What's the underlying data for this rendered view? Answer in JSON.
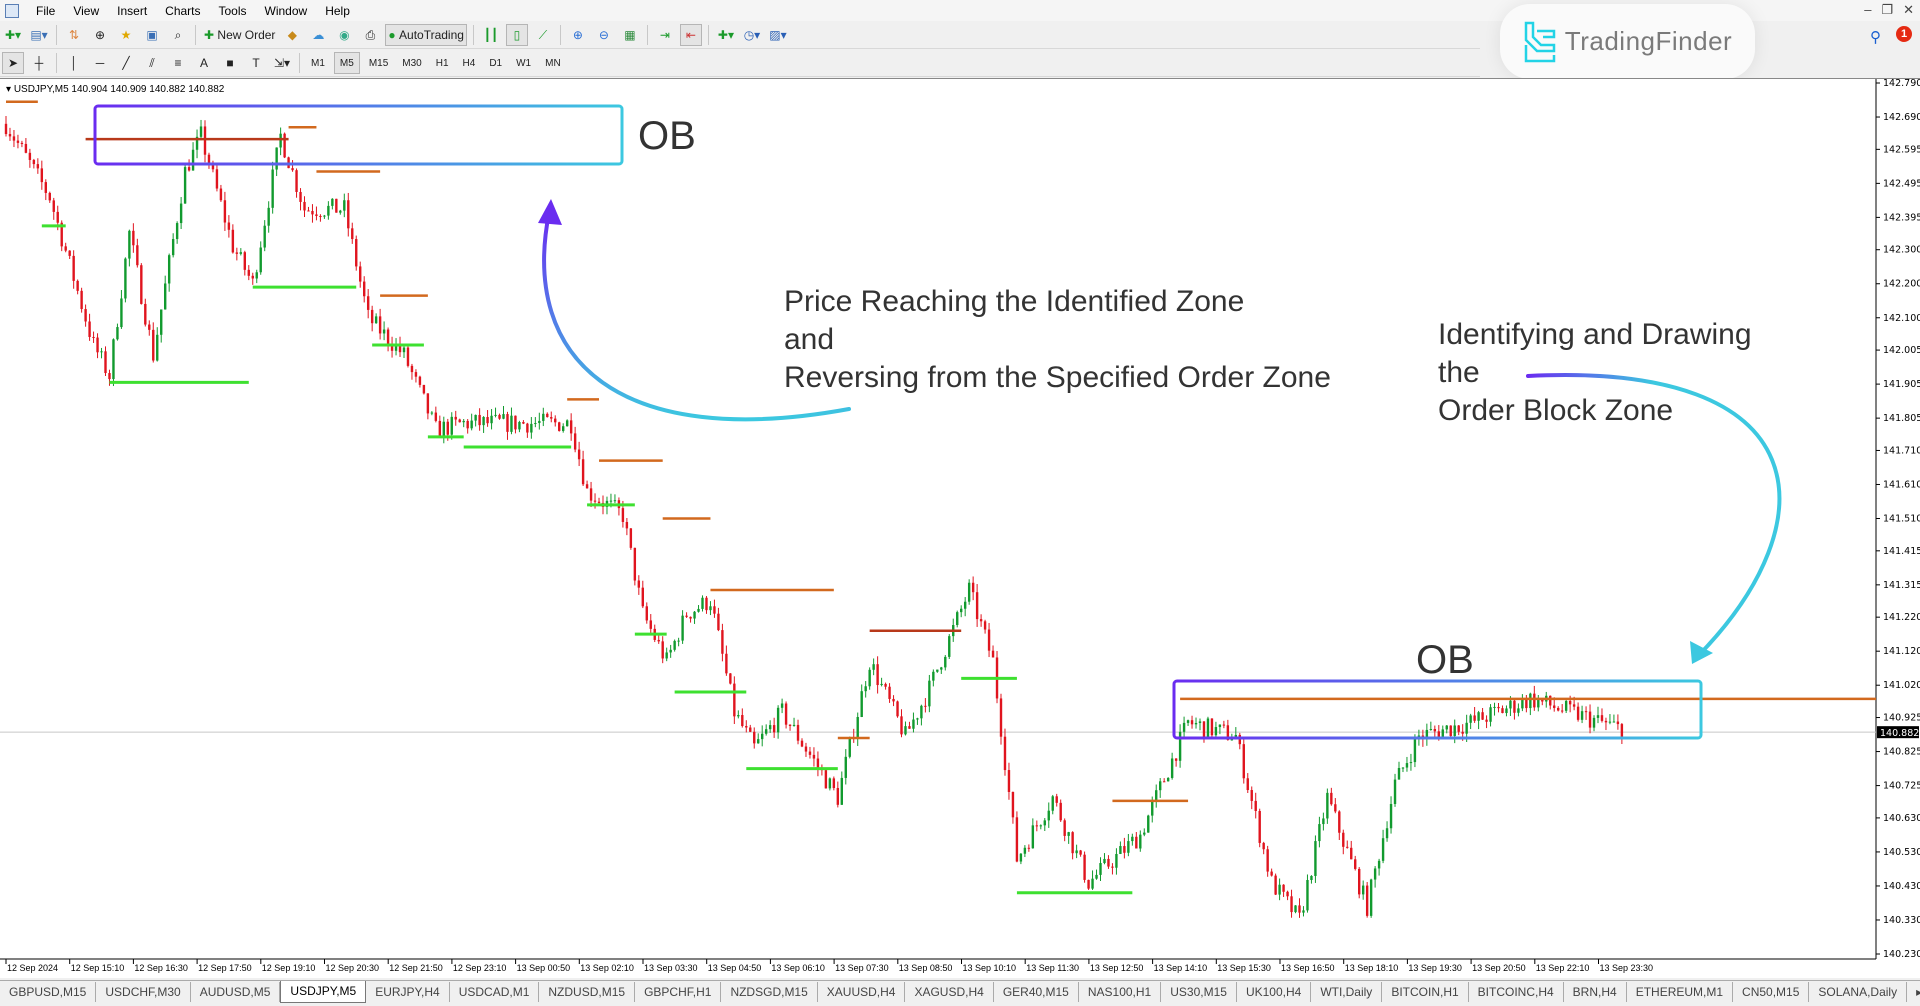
{
  "menu": [
    "File",
    "View",
    "Insert",
    "Charts",
    "Tools",
    "Window",
    "Help"
  ],
  "toolbar": {
    "new_order": "New Order",
    "auto_trading": "AutoTrading",
    "timeframes": [
      "M1",
      "M5",
      "M15",
      "M30",
      "H1",
      "H4",
      "D1",
      "W1",
      "MN"
    ],
    "active_timeframe": "M5"
  },
  "brand": {
    "logo_text": "TradingFinder",
    "accent": "#22d3e6"
  },
  "notifications": {
    "count": "1"
  },
  "chart": {
    "header": "USDJPY,M5  140.904 140.909 140.882 140.882",
    "current_price": "140.882",
    "price_labels": [
      "142.790",
      "142.690",
      "142.595",
      "142.495",
      "142.395",
      "142.300",
      "142.200",
      "142.100",
      "142.005",
      "141.905",
      "141.805",
      "141.710",
      "141.610",
      "141.510",
      "141.415",
      "141.315",
      "141.220",
      "141.120",
      "141.020",
      "140.925",
      "140.825",
      "140.725",
      "140.630",
      "140.530",
      "140.430",
      "140.330",
      "140.230"
    ],
    "time_labels": [
      "12 Sep 2024",
      "12 Sep 15:10",
      "12 Sep 16:30",
      "12 Sep 17:50",
      "12 Sep 19:10",
      "12 Sep 20:30",
      "12 Sep 21:50",
      "12 Sep 23:10",
      "13 Sep 00:50",
      "13 Sep 02:10",
      "13 Sep 03:30",
      "13 Sep 04:50",
      "13 Sep 06:10",
      "13 Sep 07:30",
      "13 Sep 08:50",
      "13 Sep 10:10",
      "13 Sep 11:30",
      "13 Sep 12:50",
      "13 Sep 14:10",
      "13 Sep 15:30",
      "13 Sep 16:50",
      "13 Sep 18:10",
      "13 Sep 19:30",
      "13 Sep 20:50",
      "13 Sep 22:10",
      "13 Sep 23:30"
    ],
    "price_range": [
      140.23,
      142.79
    ],
    "colors": {
      "bull": "#119a2e",
      "bear": "#e0141e",
      "supply": "#d2691e",
      "demand": "#3ee030",
      "box_start": "#6a2cf0",
      "box_end": "#3cc8e0"
    },
    "price_path": [
      [
        "12 Sep 13:50",
        142.67
      ],
      [
        "12 Sep 14:45",
        142.455
      ],
      [
        "12 Sep 15:40",
        142.02
      ],
      [
        "12 Sep 16:00",
        141.93
      ],
      [
        "12 Sep 16:25",
        142.35
      ],
      [
        "12 Sep 16:55",
        141.99
      ],
      [
        "12 Sep 17:35",
        142.53
      ],
      [
        "12 Sep 17:55",
        142.635
      ],
      [
        "12 Sep 18:35",
        142.31
      ],
      [
        "12 Sep 19:00",
        142.2
      ],
      [
        "12 Sep 19:35",
        142.635
      ],
      [
        "12 Sep 20:05",
        142.42
      ],
      [
        "12 Sep 20:55",
        142.42
      ],
      [
        "12 Sep 21:25",
        142.1
      ],
      [
        "12 Sep 22:10",
        141.99
      ],
      [
        "12 Sep 22:50",
        141.77
      ],
      [
        "12 Sep 23:25",
        141.79
      ],
      [
        "13 Sep 00:45",
        141.79
      ],
      [
        "13 Sep 01:40",
        141.79
      ],
      [
        "13 Sep 02:00",
        141.59
      ],
      [
        "13 Sep 02:45",
        141.52
      ],
      [
        "13 Sep 03:10",
        141.23
      ],
      [
        "13 Sep 03:40",
        141.09
      ],
      [
        "13 Sep 04:05",
        141.23
      ],
      [
        "13 Sep 04:35",
        141.27
      ],
      [
        "13 Sep 05:05",
        140.94
      ],
      [
        "13 Sep 05:30",
        140.835
      ],
      [
        "13 Sep 06:05",
        140.94
      ],
      [
        "13 Sep 07:15",
        140.69
      ],
      [
        "13 Sep 07:55",
        141.09
      ],
      [
        "13 Sep 08:40",
        140.87
      ],
      [
        "13 Sep 09:10",
        141.01
      ],
      [
        "13 Sep 10:00",
        141.3
      ],
      [
        "13 Sep 10:30",
        141.09
      ],
      [
        "13 Sep 11:00",
        140.51
      ],
      [
        "13 Sep 11:45",
        140.69
      ],
      [
        "13 Sep 12:30",
        140.44
      ],
      [
        "13 Sep 13:35",
        140.58
      ],
      [
        "13 Sep 14:35",
        140.91
      ],
      [
        "13 Sep 15:35",
        140.87
      ],
      [
        "13 Sep 16:20",
        140.44
      ],
      [
        "13 Sep 16:55",
        140.33
      ],
      [
        "13 Sep 17:30",
        140.69
      ],
      [
        "13 Sep 18:20",
        140.37
      ],
      [
        "13 Sep 18:55",
        140.73
      ],
      [
        "13 Sep 19:25",
        140.87
      ],
      [
        "13 Sep 20:30",
        140.91
      ],
      [
        "13 Sep 21:45",
        140.98
      ],
      [
        "13 Sep 23:40",
        140.89
      ]
    ],
    "levels": [
      {
        "kind": "supply",
        "price": 142.735,
        "from": "12 Sep 13:50",
        "to": "12 Sep 14:30"
      },
      {
        "kind": "supply-strong",
        "price": 142.625,
        "from": "12 Sep 15:30",
        "to": "12 Sep 19:45"
      },
      {
        "kind": "supply",
        "price": 142.66,
        "from": "12 Sep 19:45",
        "to": "12 Sep 20:20"
      },
      {
        "kind": "supply",
        "price": 142.53,
        "from": "12 Sep 20:20",
        "to": "12 Sep 21:40"
      },
      {
        "kind": "supply",
        "price": 142.165,
        "from": "12 Sep 21:40",
        "to": "12 Sep 22:40"
      },
      {
        "kind": "supply",
        "price": 141.86,
        "from": "13 Sep 01:35",
        "to": "13 Sep 02:15"
      },
      {
        "kind": "supply",
        "price": 141.68,
        "from": "13 Sep 02:15",
        "to": "13 Sep 03:35"
      },
      {
        "kind": "supply",
        "price": 141.51,
        "from": "13 Sep 03:35",
        "to": "13 Sep 04:35"
      },
      {
        "kind": "supply",
        "price": 141.3,
        "from": "13 Sep 04:35",
        "to": "13 Sep 07:10"
      },
      {
        "kind": "supply",
        "price": 140.865,
        "from": "13 Sep 07:15",
        "to": "13 Sep 07:55"
      },
      {
        "kind": "supply-strong",
        "price": 141.18,
        "from": "13 Sep 07:55",
        "to": "13 Sep 09:50"
      },
      {
        "kind": "supply",
        "price": 140.68,
        "from": "13 Sep 13:00",
        "to": "13 Sep 14:35"
      },
      {
        "kind": "supply",
        "price": 140.98,
        "from": "13 Sep 14:25",
        "to": "end"
      },
      {
        "kind": "demand",
        "price": 142.37,
        "from": "12 Sep 14:35",
        "to": "12 Sep 15:05"
      },
      {
        "kind": "demand",
        "price": 141.91,
        "from": "12 Sep 16:00",
        "to": "12 Sep 18:55"
      },
      {
        "kind": "demand",
        "price": 142.19,
        "from": "12 Sep 19:00",
        "to": "12 Sep 21:10"
      },
      {
        "kind": "demand",
        "price": 142.02,
        "from": "12 Sep 21:30",
        "to": "12 Sep 22:35"
      },
      {
        "kind": "demand",
        "price": 141.75,
        "from": "12 Sep 22:40",
        "to": "12 Sep 23:25"
      },
      {
        "kind": "demand",
        "price": 141.72,
        "from": "12 Sep 23:25",
        "to": "13 Sep 01:40"
      },
      {
        "kind": "demand",
        "price": 141.55,
        "from": "13 Sep 02:00",
        "to": "13 Sep 03:00"
      },
      {
        "kind": "demand",
        "price": 141.17,
        "from": "13 Sep 03:00",
        "to": "13 Sep 03:40"
      },
      {
        "kind": "demand",
        "price": 141.0,
        "from": "13 Sep 03:50",
        "to": "13 Sep 05:20"
      },
      {
        "kind": "demand",
        "price": 140.775,
        "from": "13 Sep 05:20",
        "to": "13 Sep 07:15"
      },
      {
        "kind": "demand",
        "price": 141.04,
        "from": "13 Sep 09:50",
        "to": "13 Sep 11:00"
      },
      {
        "kind": "demand",
        "price": 140.41,
        "from": "13 Sep 11:00",
        "to": "13 Sep 13:25"
      }
    ]
  },
  "annotations": {
    "ob_label": "OB",
    "left_text": [
      "Price Reaching the Identified Zone",
      "and",
      "Reversing from the Specified Order Zone"
    ],
    "right_text": [
      "Identifying and Drawing",
      "the",
      "Order Block Zone"
    ]
  },
  "tabs": [
    "GBPUSD,M15",
    "USDCHF,M30",
    "AUDUSD,M5",
    "USDJPY,M5",
    "EURJPY,H4",
    "USDCAD,M1",
    "NZDUSD,M15",
    "GBPCHF,H1",
    "NZDSGD,M15",
    "XAUUSD,H4",
    "XAGUSD,H4",
    "GER40,M15",
    "NAS100,H1",
    "US30,M15",
    "UK100,H4",
    "WTI,Daily",
    "BITCOIN,H1",
    "BITCOINC,H4",
    "BRN,H4",
    "ETHEREUM,M1",
    "CN50,M15",
    "SOLANA,Daily"
  ],
  "active_tab": "USDJPY,M5"
}
